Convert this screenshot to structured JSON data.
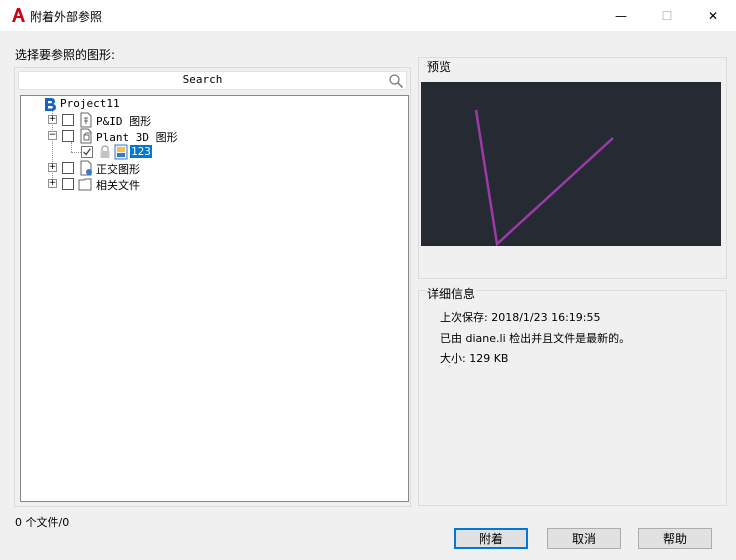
{
  "window": {
    "title": "附着外部参照",
    "minimize": "—",
    "maximize": "☐",
    "close": "✕"
  },
  "select_label": "选择要参照的图形:",
  "search": {
    "placeholder": "Search"
  },
  "tree": {
    "root": "Project11",
    "items": [
      {
        "label": "P&ID 图形"
      },
      {
        "label": "Plant 3D 图形"
      },
      {
        "label": "123",
        "selected": true
      },
      {
        "label": "正交图形"
      },
      {
        "label": "相关文件"
      }
    ]
  },
  "preview": {
    "label": "预览"
  },
  "details": {
    "label": "详细信息",
    "last_saved": "上次保存: 2018/1/23 16:19:55",
    "checked_out": "已由 diane.li 检出并且文件是最新的。",
    "size": "大小: 129 KB"
  },
  "file_count": "0 个文件/0",
  "buttons": {
    "attach": "附着",
    "cancel": "取消",
    "help": "帮助"
  },
  "colors": {
    "accent": "#0078d7",
    "preview_bg": "#262a33",
    "preview_line": "#9b3aa8",
    "app_red": "#d0021b"
  }
}
